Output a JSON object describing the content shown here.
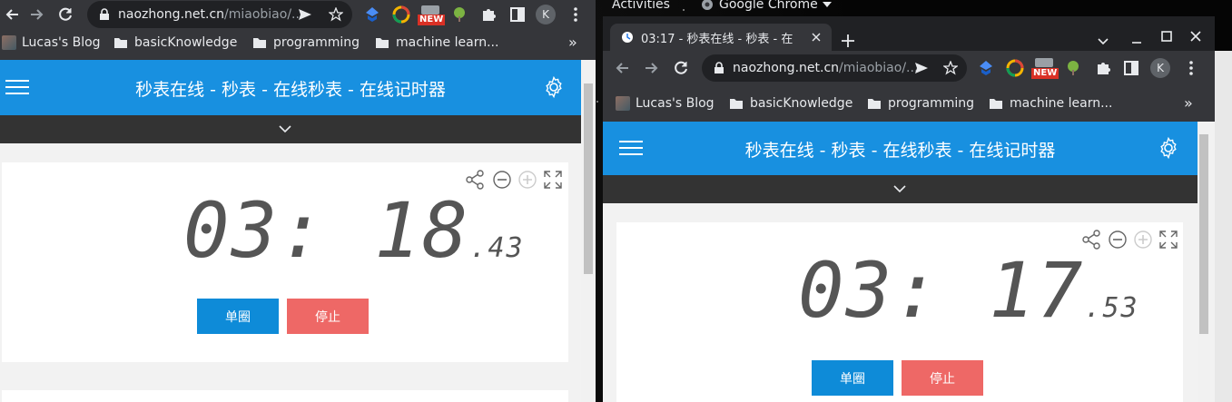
{
  "gnome": {
    "activities": "Activities",
    "app_menu": "Google Chrome"
  },
  "left_window": {
    "url_host": "naozhong.net.cn",
    "url_path": "/miaobiao/...",
    "new_badge": "NEW",
    "profile_initial": "K",
    "bookmarks": [
      "Lucas's Blog",
      "basicKnowledge",
      "programming",
      "machine learn..."
    ],
    "more_bookmarks": "»",
    "page": {
      "title": "秒表在线 - 秒表 - 在线秒表 - 在线记时器",
      "time_main": "03: 18",
      "time_fraction": ".43",
      "lap_label": "单圈",
      "stop_label": "停止"
    }
  },
  "right_window": {
    "tab_title": "03:17 - 秒表在线 - 秒表 - 在",
    "url_host": "naozhong.net.cn",
    "url_path": "/miaobiao/...",
    "new_badge": "NEW",
    "profile_initial": "K",
    "bookmarks": [
      "Lucas's Blog",
      "basicKnowledge",
      "programming",
      "machine learn..."
    ],
    "more_bookmarks": "»",
    "page": {
      "title": "秒表在线 - 秒表 - 在线秒表 - 在线记时器",
      "time_main": "03: 17",
      "time_fraction": ".53",
      "lap_label": "单圈",
      "stop_label": "停止"
    }
  },
  "colors": {
    "brand_blue": "#1890e0",
    "lap_button": "#0e8bd8",
    "stop_button": "#ee6866",
    "chrome_toolbar": "#35363a",
    "chrome_titlebar": "#202124"
  },
  "icons": [
    "back-icon",
    "forward-icon",
    "reload-icon",
    "lock-icon",
    "send-icon",
    "star-icon",
    "extension-icon",
    "puzzle-icon",
    "sidebar-icon",
    "menu-dots-icon",
    "folder-icon",
    "hamburger-icon",
    "gear-icon",
    "chevron-down-icon",
    "share-icon",
    "zoom-out-icon",
    "zoom-in-icon",
    "fullscreen-icon"
  ]
}
